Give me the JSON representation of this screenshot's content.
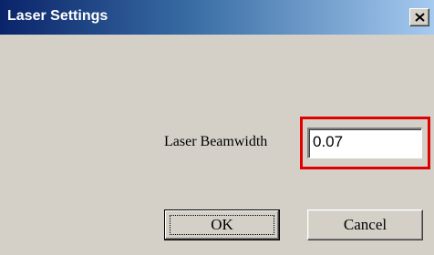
{
  "window": {
    "title": "Laser Settings",
    "close_icon": "close-x-icon"
  },
  "form": {
    "beamwidth_label": "Laser Beamwidth",
    "beamwidth_value": "0.07"
  },
  "buttons": {
    "ok_label": "OK",
    "cancel_label": "Cancel"
  },
  "colors": {
    "highlight": "#e00000",
    "titlebar_start": "#0a246a",
    "titlebar_end": "#a6caf0",
    "dialog_bg": "#d4d0c8"
  }
}
